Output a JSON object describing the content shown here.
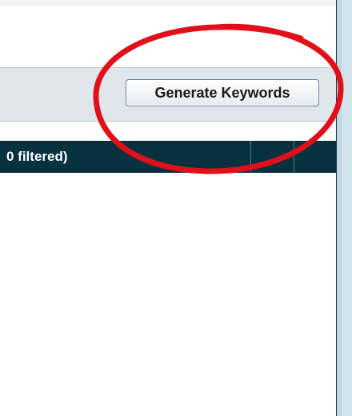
{
  "toolbar": {
    "generate_keywords_label": "Generate Keywords"
  },
  "table": {
    "header_label": "0 filtered)"
  },
  "colors": {
    "toolbar_bg": "#dfe6ec",
    "header_bg": "#07313f",
    "annotation": "#e0101a"
  },
  "icons": {
    "annotation": "red-circle-annotation"
  }
}
